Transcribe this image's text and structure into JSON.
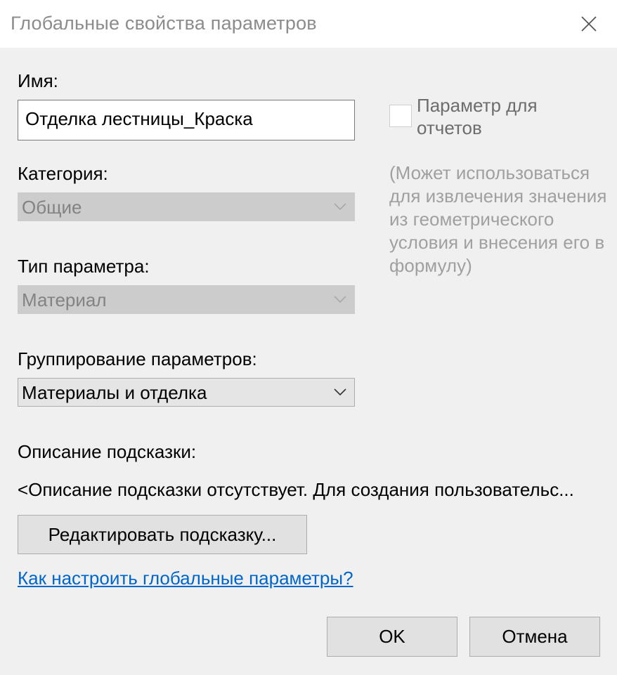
{
  "window": {
    "title": "Глобальные свойства параметров"
  },
  "name": {
    "label": "Имя:",
    "value": "Отделка лестницы_Краска"
  },
  "category": {
    "label": "Категория:",
    "value": "Общие"
  },
  "param_type": {
    "label": "Тип параметра:",
    "value": "Материал"
  },
  "grouping": {
    "label": "Группирование параметров:",
    "value": "Материалы и отделка"
  },
  "reporting": {
    "label": "Параметр для отчетов",
    "checked": false,
    "hint": "(Может использоваться для извлечения значения из геометрического условия и внесения его в формулу)"
  },
  "tooltip": {
    "label": "Описание подсказки:",
    "text": "<Описание подсказки отсутствует. Для создания пользовательс...",
    "edit_button": "Редактировать подсказку..."
  },
  "help_link": "Как настроить глобальные параметры?",
  "buttons": {
    "ok": "OK",
    "cancel": "Отмена"
  }
}
